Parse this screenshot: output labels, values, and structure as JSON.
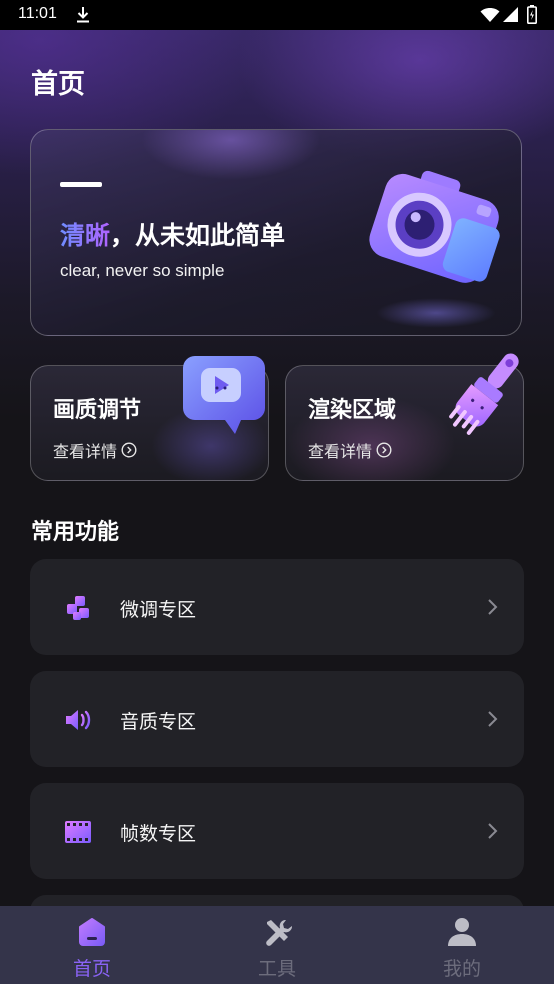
{
  "status_bar": {
    "time": "11:01"
  },
  "page": {
    "title": "首页"
  },
  "hero": {
    "title_accent": "清晰",
    "title_rest": "，从未如此简单",
    "subtitle": "clear, never so simple"
  },
  "feature_cards": [
    {
      "title": "画质调节",
      "link": "查看详情"
    },
    {
      "title": "渲染区域",
      "link": "查看详情"
    }
  ],
  "section": {
    "title": "常用功能"
  },
  "functions": [
    {
      "label": "微调专区",
      "icon": "tune-icon"
    },
    {
      "label": "音质专区",
      "icon": "speaker-icon"
    },
    {
      "label": "帧数专区",
      "icon": "film-icon"
    }
  ],
  "nav": [
    {
      "label": "首页",
      "icon": "home-icon",
      "active": true
    },
    {
      "label": "工具",
      "icon": "tools-icon",
      "active": false
    },
    {
      "label": "我的",
      "icon": "profile-icon",
      "active": false
    }
  ],
  "colors": {
    "accent": "#8a63f5",
    "accent_gradient_start": "#6f8dff",
    "accent_gradient_end": "#b063ff",
    "card_bg": "#222227",
    "nav_bg": "#34344a"
  }
}
